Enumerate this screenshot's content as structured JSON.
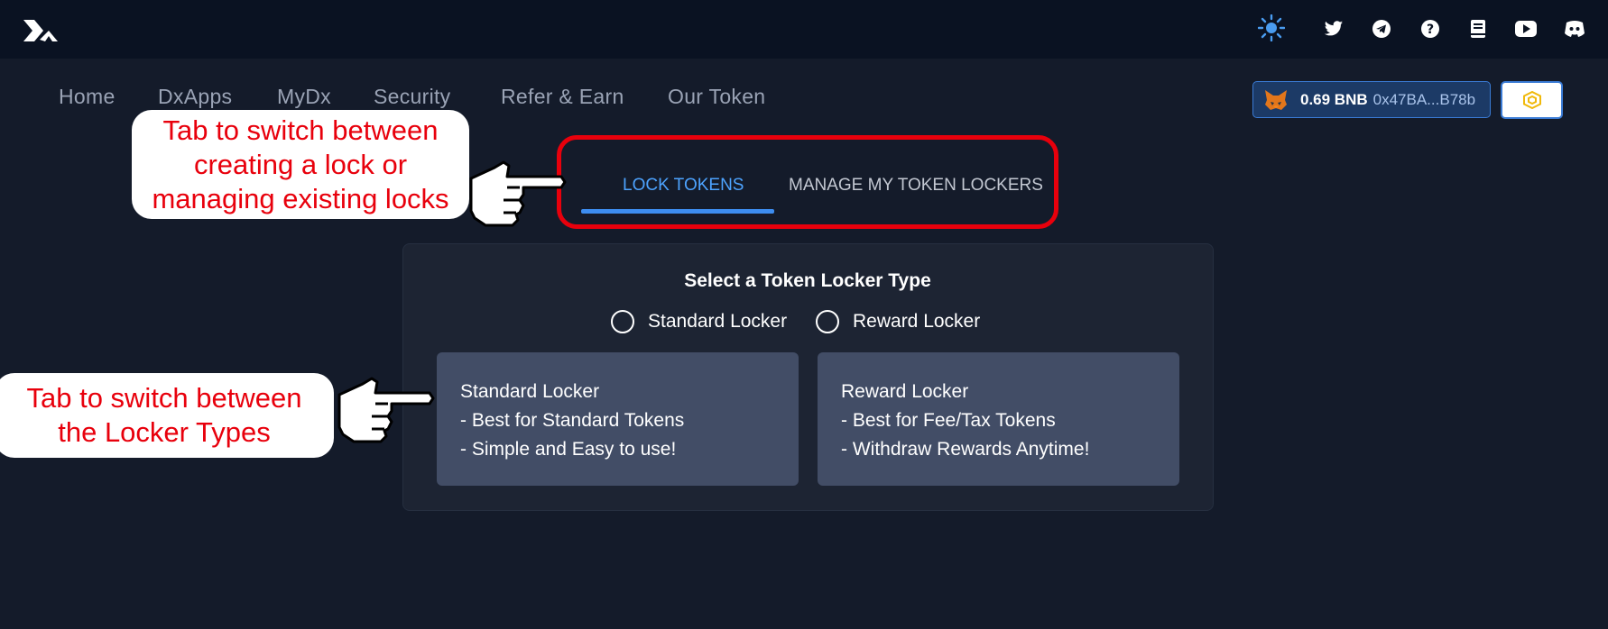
{
  "topbar": {
    "icons": [
      "sun-icon",
      "twitter-icon",
      "telegram-icon",
      "help-icon",
      "book-icon",
      "youtube-icon",
      "discord-icon"
    ]
  },
  "nav": {
    "items": [
      "Home",
      "DxApps",
      "MyDx",
      "Security",
      "Refer & Earn",
      "Our Token"
    ]
  },
  "wallet": {
    "balance": "0.69 BNB",
    "address": "0x47BA...B78b",
    "chain_icon": "bnb-chain-icon"
  },
  "tabs": {
    "lock": "LOCK TOKENS",
    "manage": "MANAGE MY TOKEN LOCKERS",
    "active": "LOCK TOKENS"
  },
  "locker": {
    "title": "Select a Token Locker Type",
    "options": [
      "Standard Locker",
      "Reward Locker"
    ],
    "cards": [
      {
        "title": "Standard Locker",
        "lines": [
          "- Best for Standard Tokens",
          "- Simple and Easy to use!"
        ]
      },
      {
        "title": "Reward Locker",
        "lines": [
          "- Best for Fee/Tax Tokens",
          "- Withdraw Rewards Anytime!"
        ]
      }
    ]
  },
  "annotations": {
    "tabs_note": [
      "Tab to switch between",
      "creating a lock or",
      "managing existing locks"
    ],
    "types_note": [
      "Tab to switch between",
      "the Locker Types"
    ]
  },
  "colors": {
    "accent": "#4da3ff",
    "annotation_red": "#e8000c",
    "background": "#141b2a",
    "topbar": "#0a1222"
  }
}
